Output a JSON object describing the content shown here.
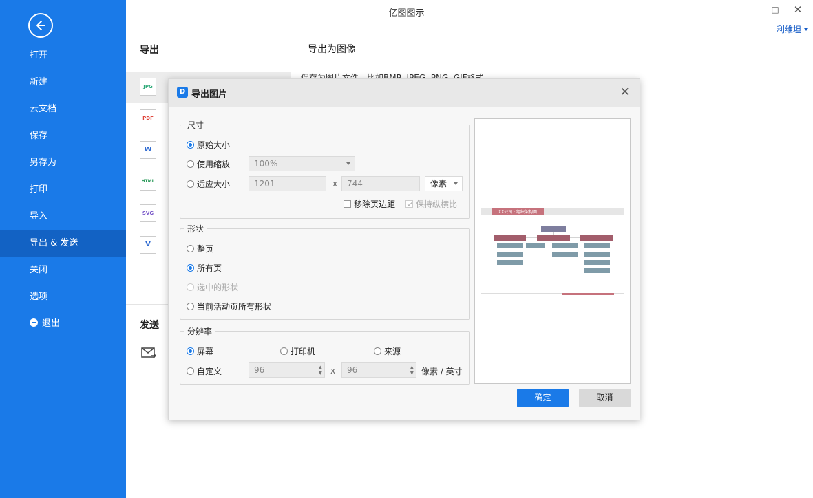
{
  "app": {
    "title": "亿图图示",
    "user": "利维坦",
    "window_controls": [
      "minimize",
      "maximize",
      "close"
    ]
  },
  "sidebar": {
    "items": [
      {
        "label": "打开"
      },
      {
        "label": "新建"
      },
      {
        "label": "云文档"
      },
      {
        "label": "保存"
      },
      {
        "label": "另存为"
      },
      {
        "label": "打印"
      },
      {
        "label": "导入"
      },
      {
        "label": "导出 & 发送",
        "active": true
      },
      {
        "label": "关闭"
      },
      {
        "label": "选项"
      },
      {
        "label": "退出",
        "icon": "exit-icon"
      }
    ]
  },
  "export_panel": {
    "header": "导出",
    "formats": [
      {
        "label": "JPG",
        "color": "#2aa876",
        "active": true
      },
      {
        "label": "PDF",
        "color": "#e0463c"
      },
      {
        "label": "W",
        "color": "#2f6bd1"
      },
      {
        "label": "HTML",
        "color": "#2a9a5a"
      },
      {
        "label": "SVG",
        "color": "#7a59c9"
      },
      {
        "label": "V",
        "color": "#2f6bd1"
      }
    ],
    "send_header": "发送"
  },
  "right_panel": {
    "header": "导出为图像",
    "description": "保存为图片文件，比如BMP, JPEG, PNG, GIF格式"
  },
  "dialog": {
    "title": "导出图片",
    "size": {
      "legend": "尺寸",
      "original_size": "原始大小",
      "use_scale": "使用缩放",
      "scale_value": "100%",
      "fit_size": "适应大小",
      "width": "1201",
      "height": "744",
      "times": "x",
      "unit": "像素",
      "remove_margin": "移除页边距",
      "keep_ratio": "保持纵横比"
    },
    "shape": {
      "legend": "形状",
      "whole_page": "整页",
      "all_pages": "所有页",
      "selected_shapes": "选中的形状",
      "current_page_shapes": "当前活动页所有形状"
    },
    "resolution": {
      "legend": "分辨率",
      "screen": "屏幕",
      "printer": "打印机",
      "source": "来源",
      "custom": "自定义",
      "dpi_x": "96",
      "dpi_y": "96",
      "times": "x",
      "unit": "像素 / 英寸"
    },
    "preview": {
      "chart_title": "XX公司 · 组织架构图"
    },
    "ok": "确定",
    "cancel": "取消"
  }
}
